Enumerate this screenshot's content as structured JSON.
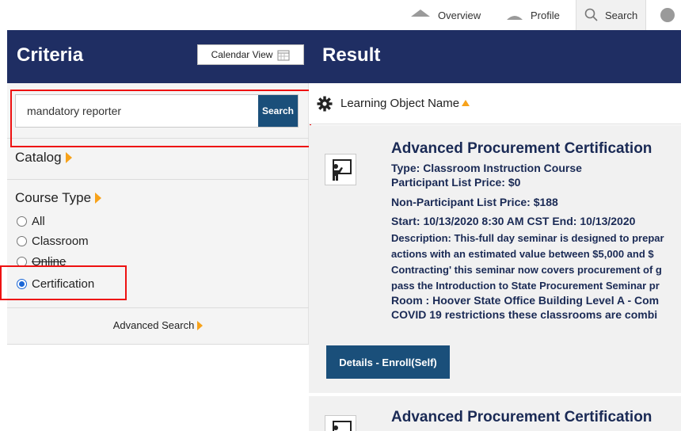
{
  "topnav": {
    "overview": "Overview",
    "profile": "Profile",
    "search": "Search"
  },
  "header": {
    "criteria_title": "Criteria",
    "calendar_view": "Calendar View",
    "result_title": "Result"
  },
  "search": {
    "value": "mandatory reporter",
    "button": "Search"
  },
  "catalog": {
    "label": "Catalog"
  },
  "course_type": {
    "label": "Course Type",
    "options": [
      "All",
      "Classroom",
      "Online",
      "Certification"
    ],
    "selected": "Certification"
  },
  "advanced_search": "Advanced Search",
  "sort": {
    "label": "Learning Object Name"
  },
  "results": [
    {
      "title": "Advanced Procurement Certification",
      "type": "Type: Classroom Instruction Course",
      "participant_price": "Participant List Price: $0",
      "non_participant_price": "Non-Participant List Price: $188",
      "schedule": "Start: 10/13/2020 8:30 AM CST End: 10/13/2020",
      "desc_lines": [
        "Description: This-full day seminar is designed to prepar",
        "actions with an estimated value between $5,000 and $",
        "Contracting' this seminar now covers procurement of g",
        "pass the Introduction to State Procurement Seminar pr"
      ],
      "room": "Room : Hoover State Office Building Level A - Com",
      "covid": "COVID 19 restrictions these classrooms are combi",
      "button": "Details - Enroll(Self)"
    },
    {
      "title": "Advanced Procurement Certification"
    }
  ],
  "colors": {
    "header_bg": "#1f2e63",
    "button_bg": "#1a4f7a",
    "accent": "#f7a21a",
    "highlight": "#e11111"
  }
}
